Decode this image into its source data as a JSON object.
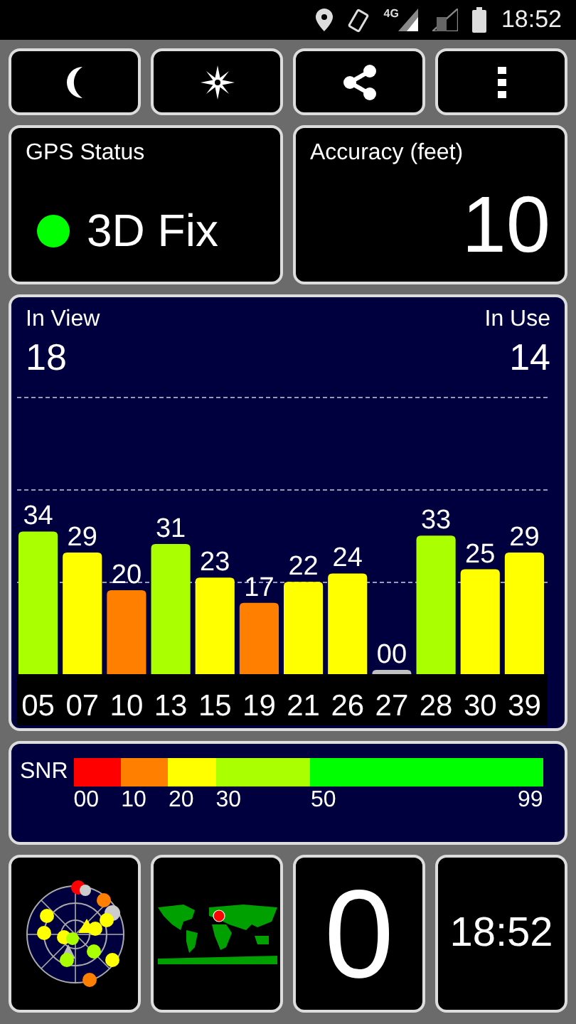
{
  "status_bar": {
    "network_type": "4G",
    "time": "18:52"
  },
  "gps_status": {
    "title": "GPS Status",
    "value": "3D Fix",
    "color": "#00ff00"
  },
  "accuracy": {
    "title": "Accuracy (feet)",
    "value": "10"
  },
  "satellites": {
    "in_view_label": "In View",
    "in_view": "18",
    "in_use_label": "In Use",
    "in_use": "14",
    "chart_data": {
      "type": "bar",
      "categories": [
        "05",
        "07",
        "10",
        "13",
        "15",
        "19",
        "21",
        "26",
        "27",
        "28",
        "30",
        "39"
      ],
      "values": [
        34,
        29,
        20,
        31,
        23,
        17,
        22,
        24,
        0,
        33,
        25,
        29
      ],
      "data_labels": true,
      "value_labels": [
        "34",
        "29",
        "20",
        "31",
        "23",
        "17",
        "22",
        "24",
        "00",
        "33",
        "25",
        "29"
      ]
    }
  },
  "snr_legend": {
    "label": "SNR",
    "ticks": [
      "00",
      "10",
      "20",
      "30",
      "50",
      "99"
    ],
    "segments": [
      {
        "color": "#ff0000"
      },
      {
        "color": "#ff8000"
      },
      {
        "color": "#ffff00"
      },
      {
        "color": "#aaff00"
      },
      {
        "color": "#00ff00"
      }
    ]
  },
  "tiles": {
    "tile_3": "0",
    "clock": "18:52"
  }
}
